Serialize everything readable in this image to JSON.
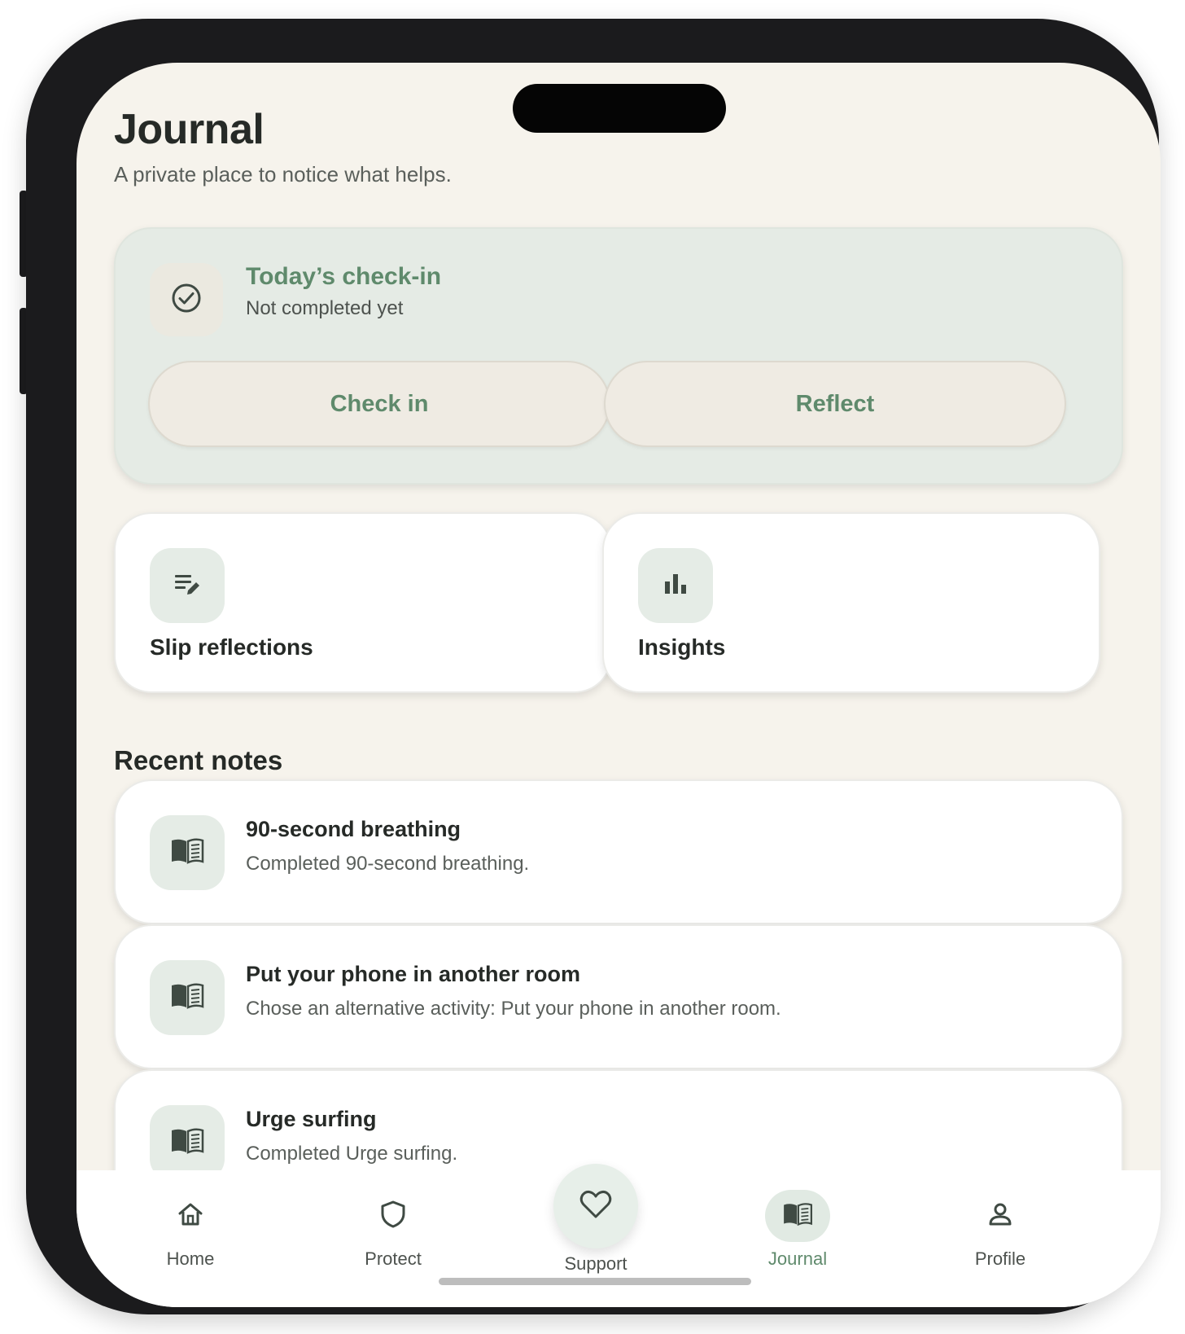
{
  "header": {
    "title": "Journal",
    "subtitle": "A private place to notice what helps."
  },
  "checkin": {
    "title": "Today’s check-in",
    "status": "Not completed yet",
    "icon": "check-circle-icon",
    "buttons": {
      "check_in": "Check in",
      "reflect": "Reflect"
    }
  },
  "tiles": {
    "slip_reflections": {
      "label": "Slip reflections",
      "icon": "edit-note-icon"
    },
    "insights": {
      "label": "Insights",
      "icon": "bar-chart-icon"
    }
  },
  "recent": {
    "title": "Recent notes",
    "notes": [
      {
        "title": "90-second breathing",
        "description": "Completed 90-second breathing.",
        "icon": "book-icon"
      },
      {
        "title": "Put your phone in another room",
        "description": "Chose an alternative activity: Put your phone in another room.",
        "icon": "book-icon"
      },
      {
        "title": "Urge surfing",
        "description": "Completed Urge surfing.",
        "icon": "book-icon"
      }
    ]
  },
  "nav": {
    "home": "Home",
    "protect": "Protect",
    "support": "Support",
    "journal": "Journal",
    "profile": "Profile",
    "active": "journal"
  },
  "colors": {
    "background": "#f6f3ec",
    "accent": "#5f8a6c",
    "checkin_card": "#e5ebe5",
    "icon_box": "#e5ece6",
    "text_primary": "#262a27"
  }
}
